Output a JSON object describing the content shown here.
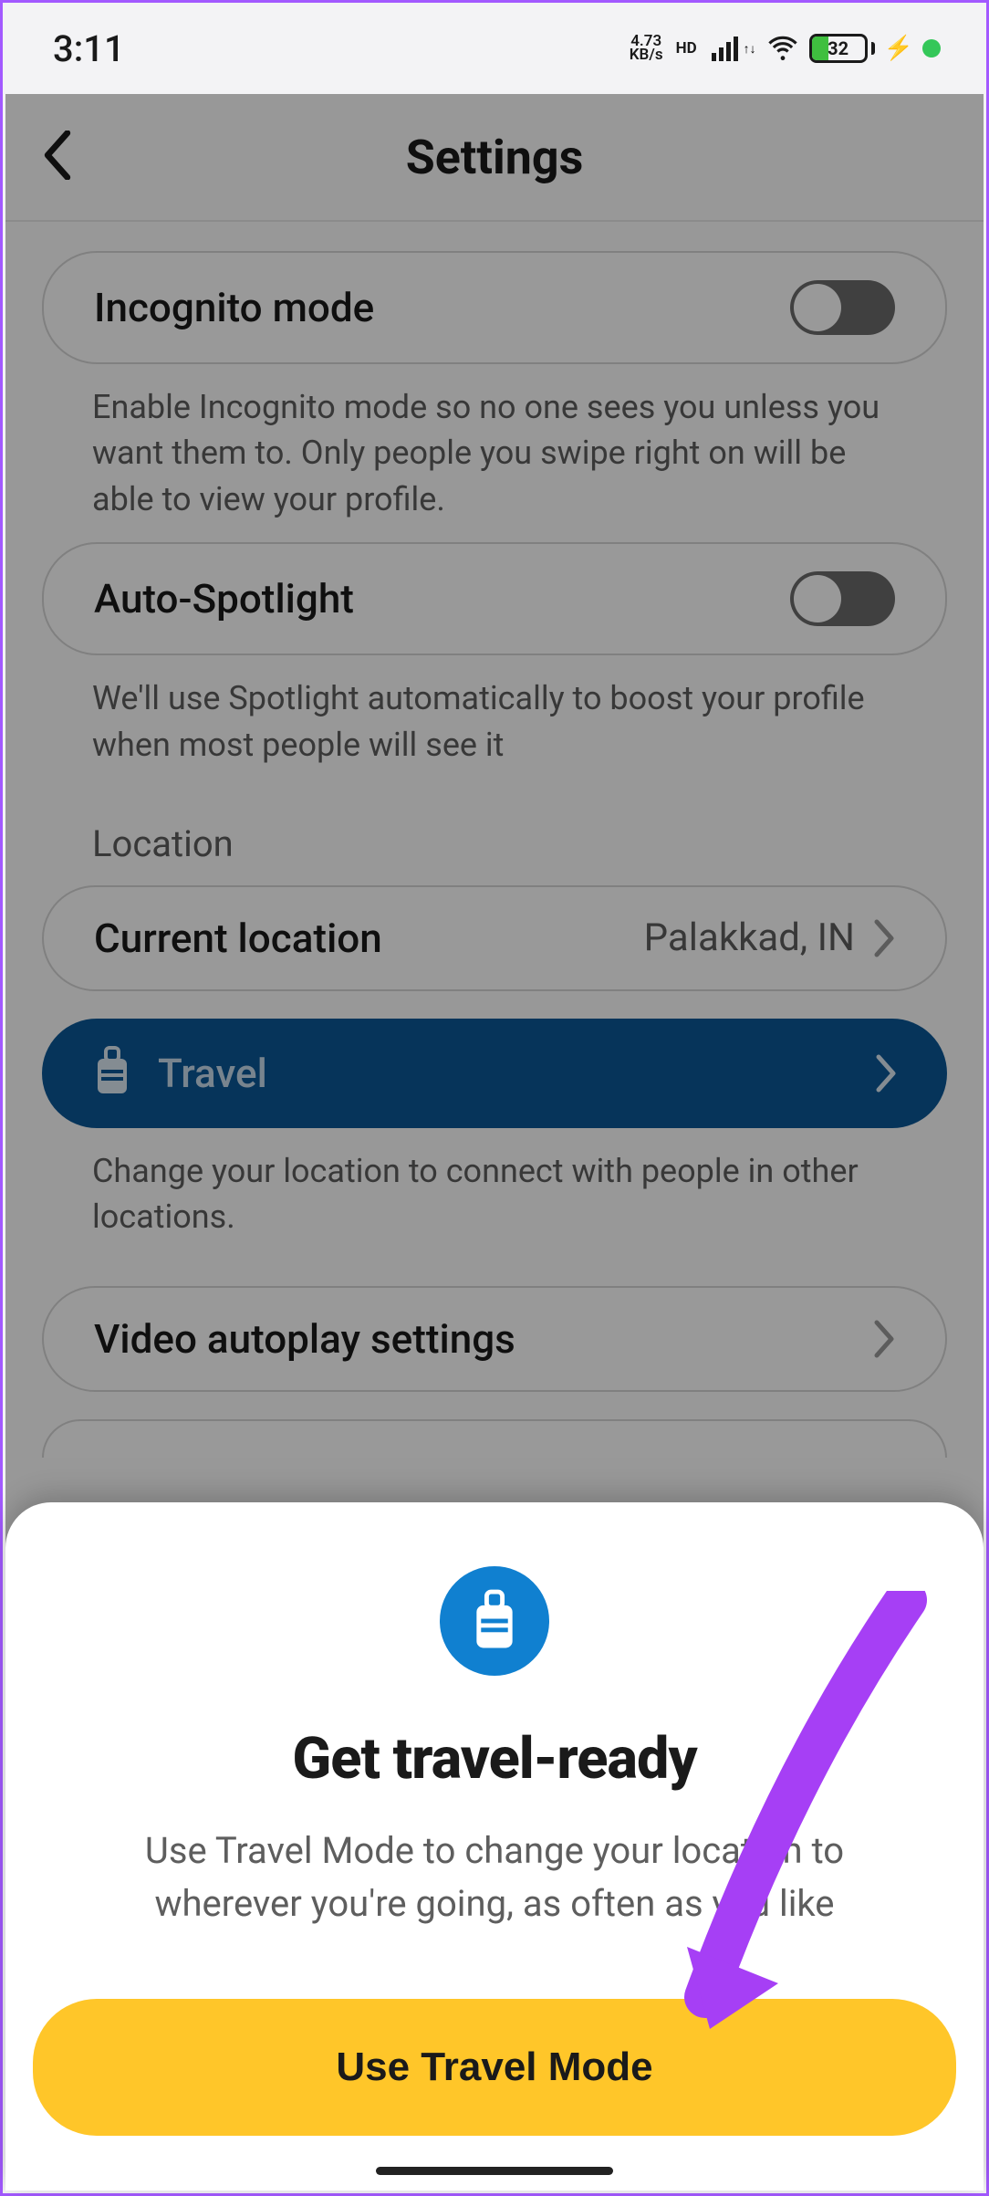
{
  "status": {
    "time": "3:11",
    "net_speed_top": "4.73",
    "net_speed_bot": "KB/s",
    "hd": "HD",
    "battery_pct": "32"
  },
  "header": {
    "title": "Settings"
  },
  "incognito": {
    "label": "Incognito mode",
    "desc": "Enable Incognito mode so no one sees you unless you want them to. Only people you swipe right on will be able to view your profile."
  },
  "autospot": {
    "label": "Auto-Spotlight",
    "desc": "We'll use Spotlight automatically to boost your profile when most people will see it"
  },
  "location": {
    "section": "Location",
    "current_label": "Current location",
    "current_value": "Palakkad, IN",
    "travel_label": "Travel",
    "travel_desc": "Change your location to connect with people in other locations."
  },
  "video": {
    "label": "Video autoplay settings"
  },
  "sheet": {
    "title": "Get travel-ready",
    "desc": "Use Travel Mode to change your location to wherever you're going, as often as you like",
    "button": "Use Travel Mode"
  }
}
